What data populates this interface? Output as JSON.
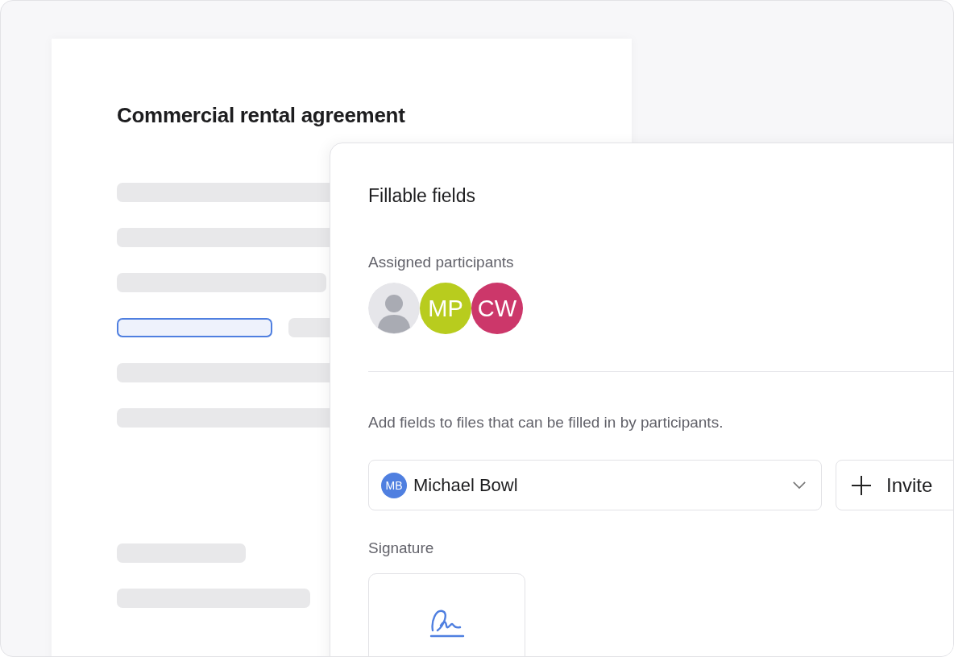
{
  "document": {
    "title": "Commercial rental agreement",
    "lines": [
      {
        "kind": "bar"
      },
      {
        "kind": "bar"
      },
      {
        "kind": "short"
      },
      {
        "kind": "field",
        "selected": true
      },
      {
        "kind": "bar"
      },
      {
        "kind": "bar"
      },
      {
        "kind": "gap"
      },
      {
        "kind": "small"
      },
      {
        "kind": "medium"
      }
    ]
  },
  "panel": {
    "title": "Fillable fields",
    "participants_label": "Assigned participants",
    "participants": [
      {
        "kind": "photo"
      },
      {
        "kind": "initials",
        "initials": "MP",
        "color": "#b8cc1e"
      },
      {
        "kind": "initials",
        "initials": "CW",
        "color": "#cc376a"
      }
    ],
    "hint": "Add fields to files that can be filled in by participants.",
    "assignee": {
      "initials": "MB",
      "name": "Michael Bowl",
      "color": "#4f7fe0"
    },
    "invite_button": "Invite",
    "signature_label": "Signature"
  }
}
